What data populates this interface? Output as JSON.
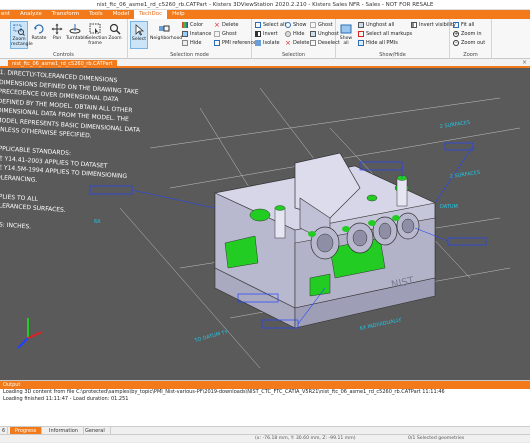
{
  "window": {
    "title": "nist_ftc_06_asme1_rd_c5260_rb.CATPart - Kisters 3DViewStation 2020.2.210 - Kisters Sales NFR - Sales - NOT FOR RESALE"
  },
  "menu": {
    "items": [
      {
        "label": "ent"
      },
      {
        "label": "Analyze"
      },
      {
        "label": "Transform"
      },
      {
        "label": "Tools"
      },
      {
        "label": "Model"
      },
      {
        "label": "TechDoc"
      },
      {
        "label": "Help"
      }
    ],
    "active_index": 5
  },
  "ribbon": {
    "controls": {
      "label": "Controls",
      "buttons": [
        "Zoom rectangle",
        "Rotate",
        "Pan",
        "Turntable",
        "Selection frame",
        "Zoom"
      ]
    },
    "selection_mode": {
      "label": "Selection mode",
      "big": [
        "Select",
        "Neighborhood"
      ],
      "small": [
        "Color",
        "Instance",
        "Hide",
        "Delete",
        "Ghost",
        "PMI reference"
      ]
    },
    "selection": {
      "label": "Selection",
      "small": [
        "Select all",
        "Invert",
        "Isolate",
        "Show",
        "Hide",
        "Delete",
        "Ghost",
        "Unghost",
        "Deselect"
      ]
    },
    "show_hide": {
      "label": "Show/Hide",
      "big": [
        "Show all"
      ],
      "small": [
        "Unghost all",
        "Select all markups",
        "Hide all PMIs",
        "Invert visibility"
      ]
    },
    "zoom": {
      "label": "Zoom",
      "small": [
        "Fit all",
        "Zoom in",
        "Zoom out"
      ]
    }
  },
  "document_tab": {
    "label": "nist_ftc_06_asme1_rd_c5260_rb.CATPart",
    "close": "×"
  },
  "viewport": {
    "notes": [
      "1. DIRECTLY-TOLERANCED DIMENSIONS",
      "DIMENSIONS DEFINED ON THE DRAWING TAKE",
      "PRECEDENCE OVER DIMENSIONAL DATA",
      "DEFINED BY THE MODEL. OBTAIN ALL OTHER",
      "DIMENSIONAL DATA FROM THE MODEL. THE",
      "MODEL REPRESENTS BASIC DIMENSIONAL DATA",
      "UNLESS OTHERWISE SPECIFIED.",
      "",
      "APPLICABLE STANDARDS:",
      "ME Y14.41-2003 APPLIES TO DATASET",
      "ME Y14.5M-1994 APPLIES TO DIMENSIONING",
      "TOLERANCING.",
      "",
      "APPLIES TO ALL",
      "TOLERANCED SURFACES.",
      "",
      "NITS: INCHES."
    ],
    "annotations": [
      "2 SURFACES",
      "2 SURFACES",
      "6X",
      "DATUM",
      "TO DATUM TY",
      "6X INDIVIDUALLY",
      "NIST"
    ]
  },
  "output": {
    "header": "Output",
    "lines": [
      "Loading 3D content from file C:\\protected\\samples\\by_topic\\PMI_Nist-various-PF\\2019-downloads\\NIST_CTC_FTC_CATIA_V5R21\\nist_ftc_06_asme1_rd_c5260_rb.CATPart 11:11:46",
      "Loading finished 11:11:47 - Load duration: 01.251"
    ],
    "tabs": [
      "Progress",
      "Information",
      "General"
    ],
    "active_tab": 0
  },
  "status": {
    "coords": "(x: -76.18 mm, Y: 30.60 mm, Z: -99.11 mm)",
    "selection": "0/1 Selected geometries"
  },
  "colors": {
    "accent": "#f27a1a",
    "viewport_bg": "#5a5a5a",
    "model_body": "#c8c8dc",
    "feature_green": "#22cc22",
    "pmi_blue": "#2244ff",
    "pmi_cyan": "#22c8e8"
  }
}
